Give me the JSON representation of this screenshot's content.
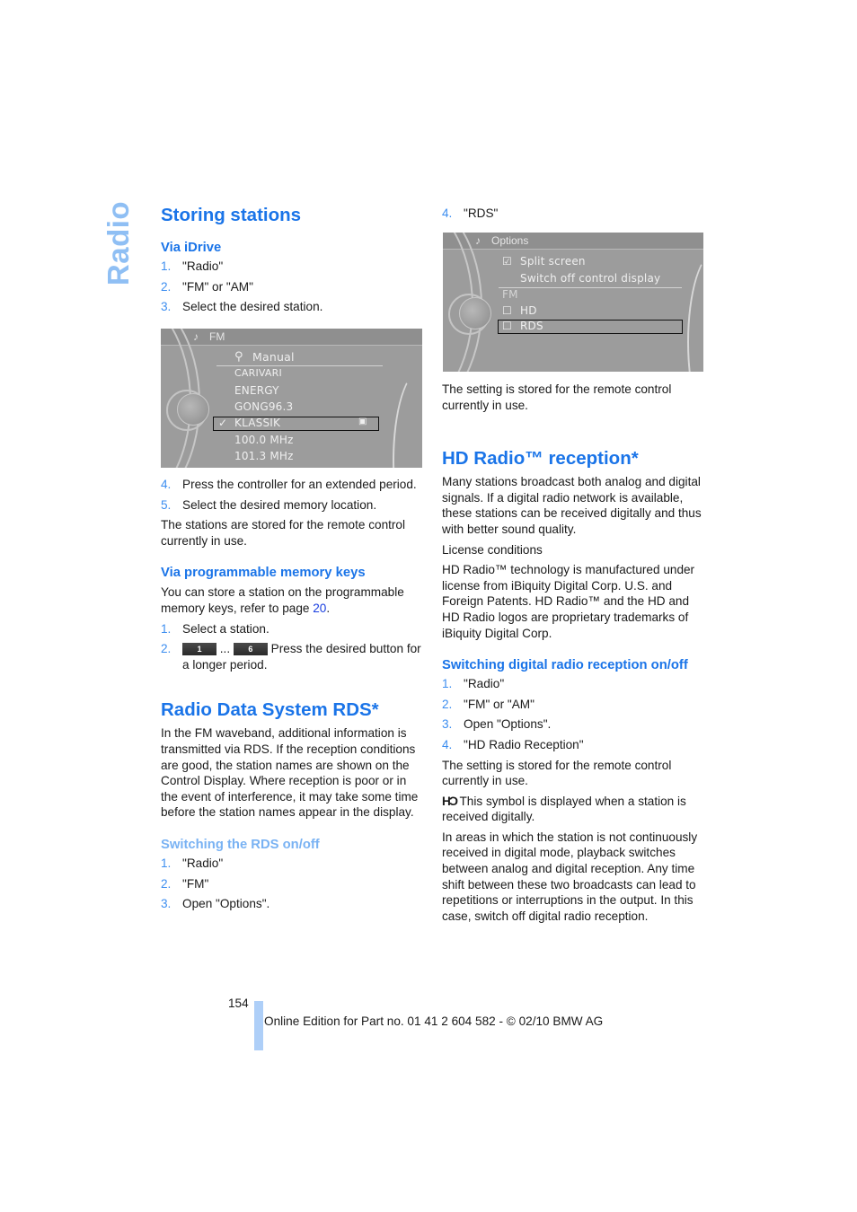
{
  "side_tab": "Radio",
  "left": {
    "storing": {
      "title": "Storing stations",
      "via_idrive": "Via iDrive",
      "steps1": [
        {
          "n": "1.",
          "t": "\"Radio\""
        },
        {
          "n": "2.",
          "t": "\"FM\" or \"AM\""
        },
        {
          "n": "3.",
          "t": "Select the desired station."
        }
      ],
      "screen": {
        "header": "FM",
        "items": [
          "Manual",
          "CARIVARI",
          "ENERGY",
          "GONG96.3",
          "KLASSIK",
          "100.0 MHz",
          "101.3 MHz"
        ],
        "selected": "KLASSIK"
      },
      "steps2": [
        {
          "n": "4.",
          "t": "Press the controller for an extended period."
        },
        {
          "n": "5.",
          "t": "Select the desired memory location."
        }
      ],
      "note": "The stations are stored for the remote control currently in use.",
      "via_keys": "Via programmable memory keys",
      "keys_text_before": "You can store a station on the programmable memory keys, refer to page ",
      "keys_page_link": "20",
      "keys_text_after": ".",
      "steps3_1": {
        "n": "1.",
        "t": "Select a station."
      },
      "steps3_2": {
        "n": "2.",
        "key_first": "1",
        "ellipsis": "...",
        "key_last": "6",
        "t": " Press the desired button for a longer period."
      }
    },
    "rds": {
      "title": "Radio Data System RDS*",
      "body": "In the FM waveband, additional information is transmitted via RDS. If the reception conditions are good, the station names are shown on the Control Display. Where reception is poor or in the event of interference, it may take some time before the station names appear in the display.",
      "switching": "Switching the RDS on/off",
      "steps": [
        {
          "n": "1.",
          "t": "\"Radio\""
        },
        {
          "n": "2.",
          "t": "\"FM\""
        },
        {
          "n": "3.",
          "t": "Open \"Options\"."
        }
      ]
    }
  },
  "right": {
    "step4": {
      "n": "4.",
      "t": "\"RDS\""
    },
    "screen": {
      "header": "Options",
      "split_screen": "Split screen",
      "switch_off": "Switch off control display",
      "fm": "FM",
      "hd": "HD",
      "rds": "RDS",
      "selected": "RDS"
    },
    "stored_note": "The setting is stored for the remote control currently in use.",
    "hd": {
      "title": "HD Radio™ reception*",
      "intro": "Many stations broadcast both analog and digital signals. If a digital radio network is available, these stations can be received digitally and thus with better sound quality.",
      "license_label": "License conditions",
      "license_text": "HD Radio™ technology is manufactured under license from iBiquity Digital Corp. U.S. and Foreign Patents. HD Radio™ and the HD and HD Radio logos are proprietary trademarks of iBiquity Digital Corp.",
      "switching": "Switching digital radio reception on/off",
      "steps": [
        {
          "n": "1.",
          "t": "\"Radio\""
        },
        {
          "n": "2.",
          "t": "\"FM\" or \"AM\""
        },
        {
          "n": "3.",
          "t": "Open \"Options\"."
        },
        {
          "n": "4.",
          "t": "\"HD Radio Reception\""
        }
      ],
      "stored_note": "The setting is stored for the remote control currently in use.",
      "symbol_text": " This symbol is displayed when a station is received digitally.",
      "symbol_icon": "hd-radio-icon",
      "final": "In areas in which the station is not continuously received in digital mode, playback switches between analog and digital reception. Any time shift between these two broadcasts can lead to repetitions or interruptions in the output. In this case, switch off digital radio reception."
    }
  },
  "footer": {
    "page_number": "154",
    "edition": "Online Edition for Part no. 01 41 2 604 582 - © 02/10 BMW AG"
  }
}
